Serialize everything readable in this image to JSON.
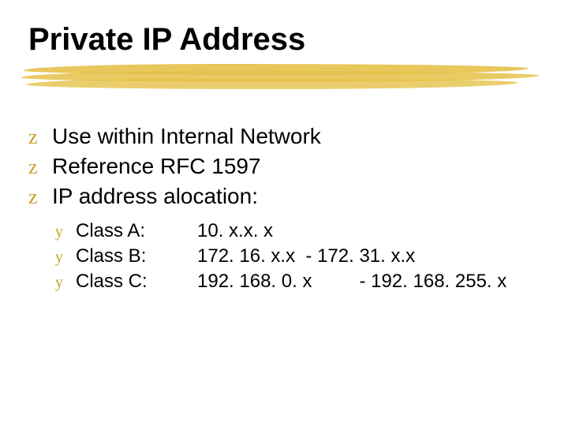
{
  "title": "Private IP Address",
  "bullets": {
    "b1": "Use within Internal Network",
    "b2": "Reference RFC 1597",
    "b3": "IP address alocation:"
  },
  "classes": {
    "a": {
      "label": "Class A:",
      "range": "10. x.x. x"
    },
    "b": {
      "label": "Class B:",
      "range": "172. 16. x.x  - 172. 31. x.x"
    },
    "c": {
      "label": "Class C:",
      "range": "192. 168. 0. x         - 192. 168. 255. x"
    }
  },
  "glyphs": {
    "z": "z",
    "y": "y"
  }
}
